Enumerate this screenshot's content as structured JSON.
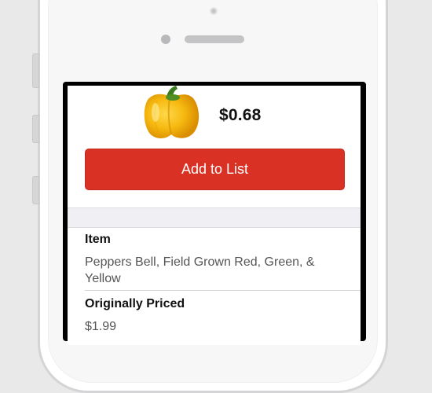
{
  "product": {
    "price": "$0.68",
    "image_icon": "bell-pepper-yellow",
    "add_button_label": "Add to List"
  },
  "details": {
    "item_label": "Item",
    "item_value": "Peppers Bell, Field Grown Red, Green, & Yellow",
    "orig_label": "Originally Priced",
    "orig_value": "$1.99"
  },
  "colors": {
    "accent": "#d93124",
    "band": "#efeff4",
    "device_frame": "#d4d4d6"
  }
}
